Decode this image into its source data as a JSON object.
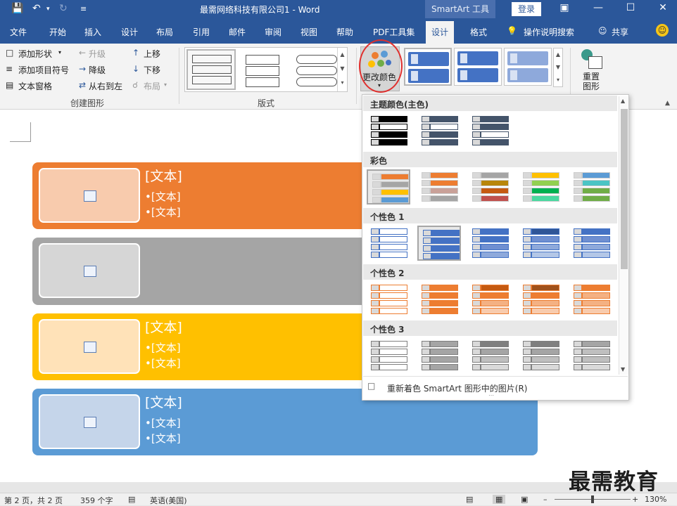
{
  "window": {
    "title": "最需网络科技有限公司1  -  Word",
    "context_tools": "SmartArt 工具",
    "login_label": "登录",
    "qa_icons": [
      "save-icon",
      "undo-icon",
      "redo-icon",
      "customize-icon"
    ]
  },
  "tabs": [
    "文件",
    "开始",
    "插入",
    "设计",
    "布局",
    "引用",
    "邮件",
    "审阅",
    "视图",
    "帮助",
    "PDF工具集",
    "设计",
    "格式",
    "操作说明搜索",
    "共享"
  ],
  "ribbon": {
    "create_graphic": {
      "add_shape": "添加形状",
      "add_bullet": "添加项目符号",
      "text_pane": "文本窗格",
      "promote": "升级",
      "demote": "降级",
      "right_to_left": "从右到左",
      "move_up": "上移",
      "move_down": "下移",
      "layout_btn": "布局",
      "group_label": "创建图形"
    },
    "layouts_label": "版式",
    "change_colors": "更改颜色",
    "reset": "重置\n图形"
  },
  "colors": {
    "orange": "#ed7d31",
    "gray": "#a5a5a5",
    "gold": "#ffc000",
    "blue": "#5b9bd5",
    "word_blue": "#2b579a"
  },
  "smartart": {
    "rows": [
      {
        "title": "[文本]",
        "bullets": [
          "•[文本]",
          "•[文本]"
        ]
      },
      {
        "title": "",
        "bullets": []
      },
      {
        "title": "[文本]",
        "bullets": [
          "•[文本]",
          "•[文本]"
        ]
      },
      {
        "title": "[文本]",
        "bullets": [
          "•[文本]",
          "•[文本]"
        ]
      }
    ]
  },
  "dropdown": {
    "sections": [
      "主题颜色(主色)",
      "彩色",
      "个性色 1",
      "个性色 2",
      "个性色 3"
    ],
    "footer": "重新着色 SmartArt 图形中的图片(R)"
  },
  "status": {
    "page": "第 2 页，共 2 页",
    "words": "359 个字",
    "language": "英语(美国)",
    "zoom": "130%"
  },
  "watermark": "最需教育"
}
